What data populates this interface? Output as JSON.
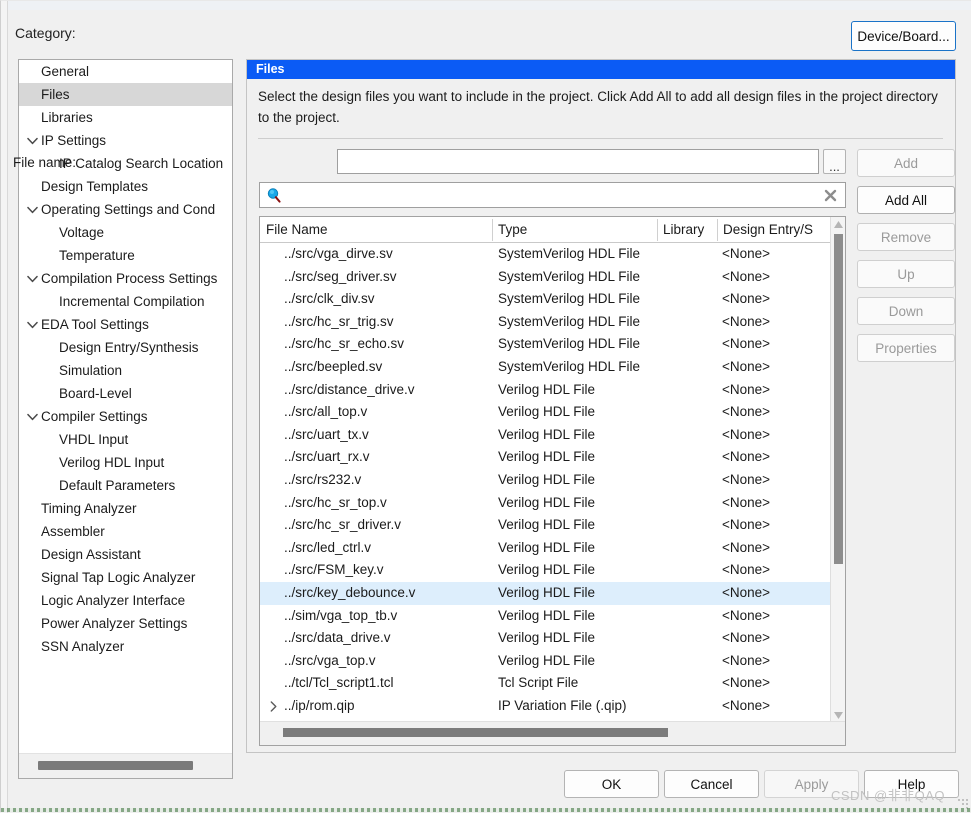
{
  "header": {
    "category_label": "Category:",
    "device_board_button": "Device/Board..."
  },
  "sidebar": {
    "items": [
      {
        "label": "General",
        "depth": 0,
        "expander": "none",
        "selected": false
      },
      {
        "label": "Files",
        "depth": 0,
        "expander": "none",
        "selected": true
      },
      {
        "label": "Libraries",
        "depth": 0,
        "expander": "none",
        "selected": false
      },
      {
        "label": "IP Settings",
        "depth": 0,
        "expander": "expanded",
        "selected": false
      },
      {
        "label": "IP Catalog Search Location",
        "depth": 1,
        "expander": "none",
        "selected": false
      },
      {
        "label": "Design Templates",
        "depth": 0,
        "expander": "none",
        "selected": false
      },
      {
        "label": "Operating Settings and Cond",
        "depth": 0,
        "expander": "expanded",
        "selected": false
      },
      {
        "label": "Voltage",
        "depth": 1,
        "expander": "none",
        "selected": false
      },
      {
        "label": "Temperature",
        "depth": 1,
        "expander": "none",
        "selected": false
      },
      {
        "label": "Compilation Process Settings",
        "depth": 0,
        "expander": "expanded",
        "selected": false
      },
      {
        "label": "Incremental Compilation",
        "depth": 1,
        "expander": "none",
        "selected": false
      },
      {
        "label": "EDA Tool Settings",
        "depth": 0,
        "expander": "expanded",
        "selected": false
      },
      {
        "label": "Design Entry/Synthesis",
        "depth": 1,
        "expander": "none",
        "selected": false
      },
      {
        "label": "Simulation",
        "depth": 1,
        "expander": "none",
        "selected": false
      },
      {
        "label": "Board-Level",
        "depth": 1,
        "expander": "none",
        "selected": false
      },
      {
        "label": "Compiler Settings",
        "depth": 0,
        "expander": "expanded",
        "selected": false
      },
      {
        "label": "VHDL Input",
        "depth": 1,
        "expander": "none",
        "selected": false
      },
      {
        "label": "Verilog HDL Input",
        "depth": 1,
        "expander": "none",
        "selected": false
      },
      {
        "label": "Default Parameters",
        "depth": 1,
        "expander": "none",
        "selected": false
      },
      {
        "label": "Timing Analyzer",
        "depth": 0,
        "expander": "none",
        "selected": false
      },
      {
        "label": "Assembler",
        "depth": 0,
        "expander": "none",
        "selected": false
      },
      {
        "label": "Design Assistant",
        "depth": 0,
        "expander": "none",
        "selected": false
      },
      {
        "label": "Signal Tap Logic Analyzer",
        "depth": 0,
        "expander": "none",
        "selected": false
      },
      {
        "label": "Logic Analyzer Interface",
        "depth": 0,
        "expander": "none",
        "selected": false
      },
      {
        "label": "Power Analyzer Settings",
        "depth": 0,
        "expander": "none",
        "selected": false
      },
      {
        "label": "SSN Analyzer",
        "depth": 0,
        "expander": "none",
        "selected": false
      }
    ]
  },
  "panel": {
    "title": "Files",
    "description": "Select the design files you want to include in the project. Click Add All to add all design files in the project directory to the project.",
    "filename_label": "File name:",
    "filename_value": "",
    "filename_placeholder": "",
    "browse_button": "...",
    "search_value": "",
    "search_placeholder": "",
    "search_icon": "search-icon",
    "clear_icon": "clear-icon"
  },
  "table": {
    "columns": [
      "File Name",
      "Type",
      "Library",
      "Design Entry/S"
    ],
    "rows": [
      {
        "name": "../src/vga_dirve.sv",
        "type": "SystemVerilog HDL File",
        "library": "",
        "entry": "<None>",
        "selected": false,
        "expander": false
      },
      {
        "name": "../src/seg_driver.sv",
        "type": "SystemVerilog HDL File",
        "library": "",
        "entry": "<None>",
        "selected": false,
        "expander": false
      },
      {
        "name": "../src/clk_div.sv",
        "type": "SystemVerilog HDL File",
        "library": "",
        "entry": "<None>",
        "selected": false,
        "expander": false
      },
      {
        "name": "../src/hc_sr_trig.sv",
        "type": "SystemVerilog HDL File",
        "library": "",
        "entry": "<None>",
        "selected": false,
        "expander": false
      },
      {
        "name": "../src/hc_sr_echo.sv",
        "type": "SystemVerilog HDL File",
        "library": "",
        "entry": "<None>",
        "selected": false,
        "expander": false
      },
      {
        "name": "../src/beepled.sv",
        "type": "SystemVerilog HDL File",
        "library": "",
        "entry": "<None>",
        "selected": false,
        "expander": false
      },
      {
        "name": "../src/distance_drive.v",
        "type": "Verilog HDL File",
        "library": "",
        "entry": "<None>",
        "selected": false,
        "expander": false
      },
      {
        "name": "../src/all_top.v",
        "type": "Verilog HDL File",
        "library": "",
        "entry": "<None>",
        "selected": false,
        "expander": false
      },
      {
        "name": "../src/uart_tx.v",
        "type": "Verilog HDL File",
        "library": "",
        "entry": "<None>",
        "selected": false,
        "expander": false
      },
      {
        "name": "../src/uart_rx.v",
        "type": "Verilog HDL File",
        "library": "",
        "entry": "<None>",
        "selected": false,
        "expander": false
      },
      {
        "name": "../src/rs232.v",
        "type": "Verilog HDL File",
        "library": "",
        "entry": "<None>",
        "selected": false,
        "expander": false
      },
      {
        "name": "../src/hc_sr_top.v",
        "type": "Verilog HDL File",
        "library": "",
        "entry": "<None>",
        "selected": false,
        "expander": false
      },
      {
        "name": "../src/hc_sr_driver.v",
        "type": "Verilog HDL File",
        "library": "",
        "entry": "<None>",
        "selected": false,
        "expander": false
      },
      {
        "name": "../src/led_ctrl.v",
        "type": "Verilog HDL File",
        "library": "",
        "entry": "<None>",
        "selected": false,
        "expander": false
      },
      {
        "name": "../src/FSM_key.v",
        "type": "Verilog HDL File",
        "library": "",
        "entry": "<None>",
        "selected": false,
        "expander": false
      },
      {
        "name": "../src/key_debounce.v",
        "type": "Verilog HDL File",
        "library": "",
        "entry": "<None>",
        "selected": true,
        "expander": false
      },
      {
        "name": "../sim/vga_top_tb.v",
        "type": "Verilog HDL File",
        "library": "",
        "entry": "<None>",
        "selected": false,
        "expander": false
      },
      {
        "name": "../src/data_drive.v",
        "type": "Verilog HDL File",
        "library": "",
        "entry": "<None>",
        "selected": false,
        "expander": false
      },
      {
        "name": "../src/vga_top.v",
        "type": "Verilog HDL File",
        "library": "",
        "entry": "<None>",
        "selected": false,
        "expander": false
      },
      {
        "name": "../tcl/Tcl_script1.tcl",
        "type": "Tcl Script File",
        "library": "",
        "entry": "<None>",
        "selected": false,
        "expander": false
      },
      {
        "name": "../ip/rom.qip",
        "type": "IP Variation File (.qip)",
        "library": "",
        "entry": "<None>",
        "selected": false,
        "expander": true
      }
    ]
  },
  "side_buttons": [
    {
      "label": "Add",
      "enabled": false
    },
    {
      "label": "Add All",
      "enabled": true
    },
    {
      "label": "Remove",
      "enabled": false
    },
    {
      "label": "Up",
      "enabled": false
    },
    {
      "label": "Down",
      "enabled": false
    },
    {
      "label": "Properties",
      "enabled": false
    }
  ],
  "bottom_buttons": {
    "ok": "OK",
    "cancel": "Cancel",
    "apply": "Apply",
    "help": "Help"
  },
  "watermark": "CSDN @非非QAQ",
  "colors": {
    "title_bar": "#0b5bf5",
    "selected_row": "#ddeefc",
    "selected_tree_item": "#d7d7d7",
    "focus_border": "#1a73c8"
  }
}
